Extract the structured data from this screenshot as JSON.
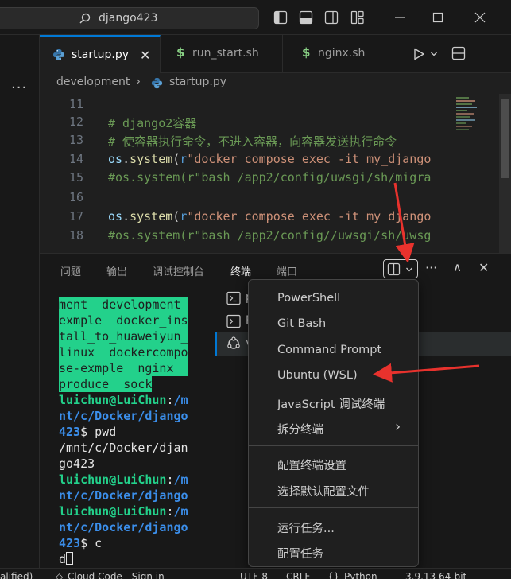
{
  "titlebar": {
    "search_text": "django423",
    "accent": "#0078d4"
  },
  "left_strip": {
    "more": "···"
  },
  "tabs": [
    {
      "label": "startup.py",
      "icon": "python-icon",
      "active": true,
      "close": "✕"
    },
    {
      "label": "run_start.sh",
      "icon": "shell-dollar-icon",
      "active": false
    },
    {
      "label": "nginx.sh",
      "icon": "shell-dollar-icon",
      "active": false
    }
  ],
  "breadcrumb": {
    "folder": "development",
    "separator": "›",
    "file": "startup.py"
  },
  "editor": {
    "lines": [
      {
        "num": "11"
      },
      {
        "num": "12",
        "comment": "# django2容器"
      },
      {
        "num": "13",
        "comment": "# 使容器执行命令，不进入容器，向容器发送执行命令"
      },
      {
        "num": "14",
        "mod": "os",
        "dot": ".",
        "fn": "system",
        "open": "(",
        "pre": "r",
        "str": "\"docker compose exec -it my_django"
      },
      {
        "num": "15",
        "comment": "#os.system(r\"bash /app2/config/uwsgi/sh/migra"
      },
      {
        "num": "16"
      },
      {
        "num": "17",
        "mod": "os",
        "dot": ".",
        "fn": "system",
        "open": "(",
        "pre": "r",
        "str": "\"docker compose exec -it my_django"
      },
      {
        "num": "18",
        "comment": "#os.system(r\"bash /app2/config//uwsgi/sh/uwsg"
      }
    ]
  },
  "panel": {
    "tabs": [
      "问题",
      "输出",
      "调试控制台",
      "终端",
      "端口"
    ],
    "active_tab": "终端",
    "more": "···",
    "chevron_up": "∧",
    "close": "✕"
  },
  "terminal": {
    "hl_lines": [
      "ment  development ",
      "exmple  docker_ins",
      "tall_to_huaweiyun_",
      "linux  dockercompo",
      "se-exmple  nginx  ",
      "produce  sock"
    ],
    "prompt_user": "luichun@LuiChun",
    "prompt_colon": ":",
    "path_a": "/m",
    "path_b": "nt/c/Docker/django",
    "path_c": "423",
    "dollar": "$ ",
    "cmd1": "pwd",
    "out1": "/mnt/c/Docker/djan",
    "out2": "go423",
    "cmd2": "c",
    "last_input": "d"
  },
  "term_list": {
    "items": [
      {
        "icon": "terminal-icon",
        "label": "p"
      },
      {
        "icon": "terminal-icon",
        "label": "P"
      },
      {
        "icon": "ubuntu-icon",
        "label": "v"
      }
    ]
  },
  "dropdown": {
    "items": [
      "PowerShell",
      "Git Bash",
      "Command Prompt",
      "Ubuntu (WSL)",
      "JavaScript 调试终端",
      "拆分终端",
      "配置终端设置",
      "选择默认配置文件",
      "运行任务...",
      "配置任务"
    ],
    "submenu_arrow": "›"
  },
  "statusbar": {
    "left": "alified)",
    "cloud": "Cloud Code - Sign in",
    "encoding": "UTF-8",
    "eol": "CRLF",
    "braces": "{}",
    "language": "Python",
    "version": "3.9.13 64-bit"
  },
  "colors": {
    "annotation": "#e8322d",
    "terminal_highlight": "#23d18b",
    "prompt_blue": "#3b8eea"
  }
}
